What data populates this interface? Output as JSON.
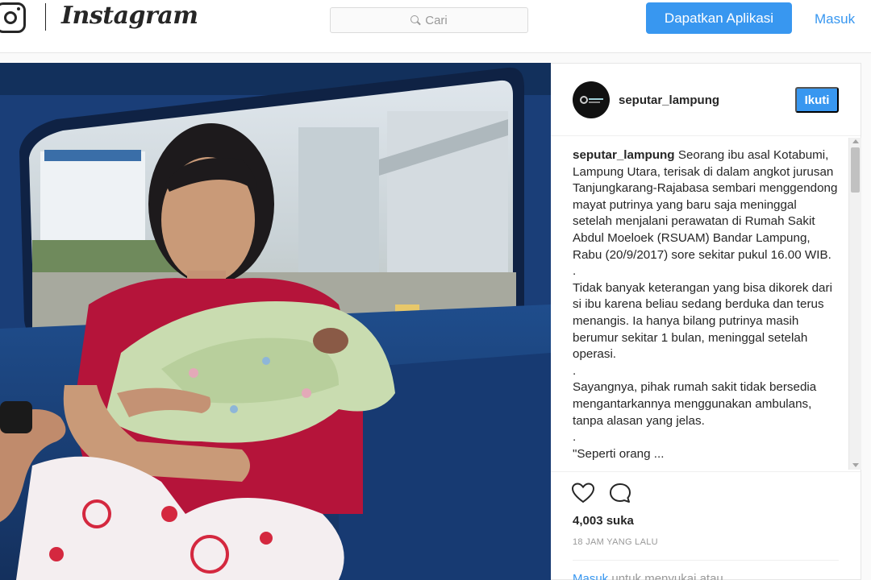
{
  "nav": {
    "brand": "Instagram",
    "search_placeholder": "Cari",
    "get_app_label": "Dapatkan Aplikasi",
    "login_label": "Masuk"
  },
  "post": {
    "username": "seputar_lampung",
    "follow_label": "Ikuti",
    "caption_username": "seputar_lampung",
    "caption_text": " Seorang ibu asal Kotabumi, Lampung Utara, terisak di dalam angkot jurusan Tanjungkarang-Rajabasa sembari menggendong mayat putrinya yang baru saja meninggal setelah menjalani perawatan di Rumah Sakit Abdul Moeloek (RSUAM) Bandar Lampung, Rabu (20/9/2017) sore sekitar pukul 16.00 WIB.\n.\nTidak banyak keterangan yang bisa dikorek dari si ibu karena beliau sedang berduka dan terus menangis. Ia hanya bilang putrinya masih berumur sekitar 1 bulan, meninggal setelah operasi.\n.\nSayangnya, pihak rumah sakit tidak bersedia mengantarkannya menggunakan ambulans, tanpa alasan yang jelas.\n.\n\"Seperti orang ...",
    "likes": "4,003 suka",
    "time_ago": "18 JAM YANG LALU",
    "login_prompt_link": "Masuk",
    "login_prompt_text": " untuk menyukai atau"
  },
  "colors": {
    "accent": "#3897f0",
    "text": "#262626",
    "muted": "#999999"
  },
  "icons": {
    "logo": "instagram-camera-icon",
    "search": "search-icon",
    "like": "heart-icon",
    "comment": "comment-icon"
  }
}
